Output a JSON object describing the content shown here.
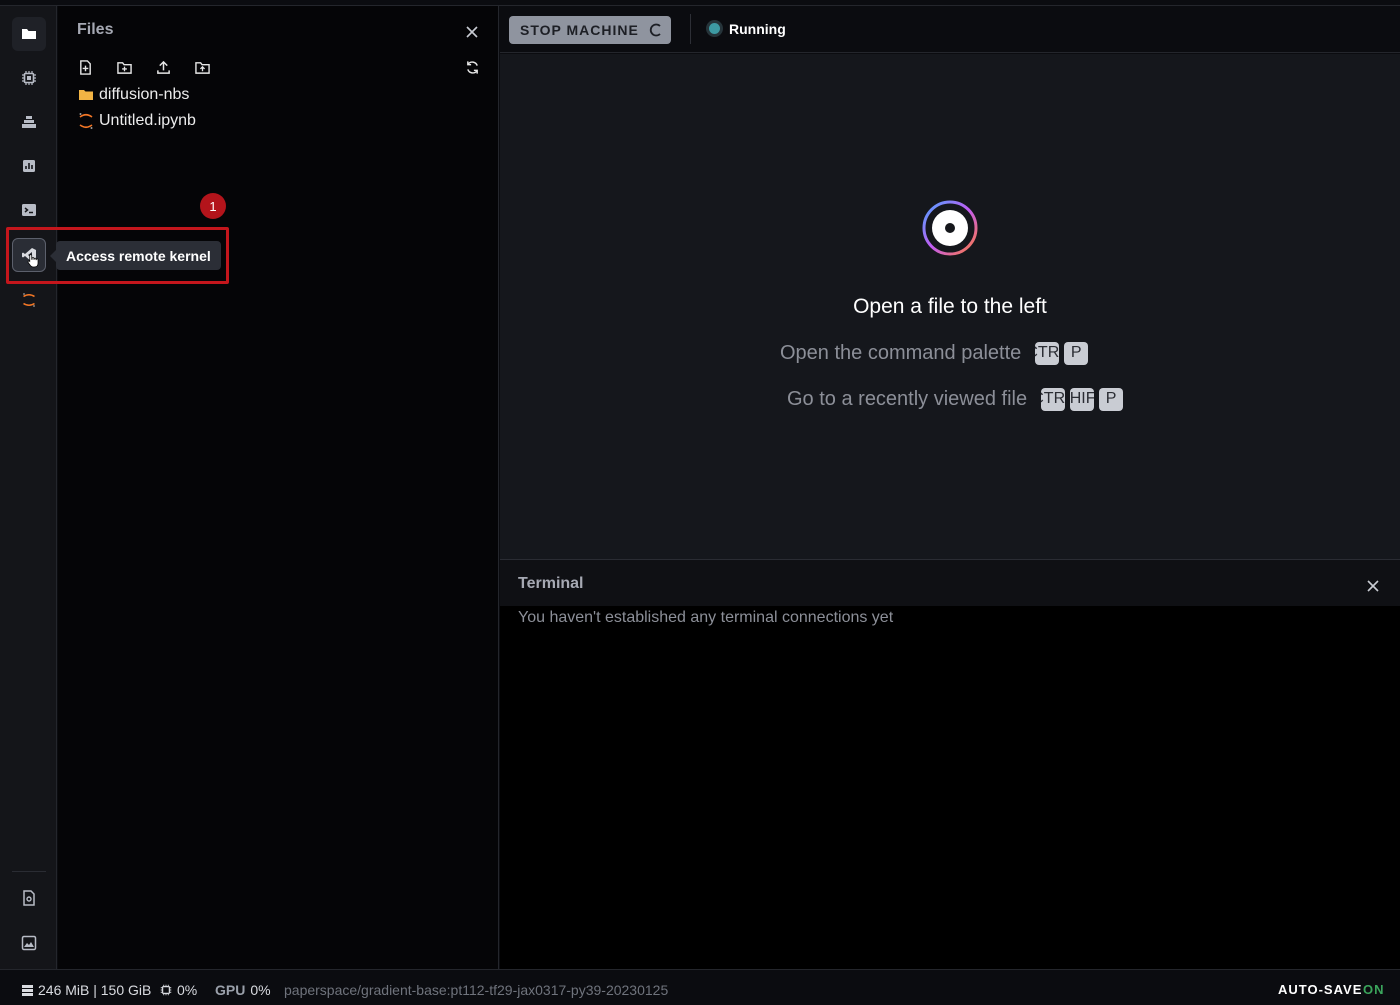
{
  "files_panel": {
    "title": "Files",
    "toolbar_icons": [
      "new-file-icon",
      "new-folder-icon",
      "upload-icon",
      "upload-folder-icon",
      "refresh-icon"
    ],
    "items": [
      {
        "name": "diffusion-nbs",
        "icon": "folder-icon"
      },
      {
        "name": "Untitled.ipynb",
        "icon": "jupyter-icon"
      }
    ]
  },
  "activity_bar": {
    "items": [
      "files-icon",
      "cpu-icon",
      "layers-icon",
      "chart-icon",
      "terminal-icon",
      "vscode-icon",
      "jupyter-icon"
    ],
    "bottom_items": [
      "notebook-icon",
      "image-settings-icon"
    ]
  },
  "annotation": {
    "badge": "1"
  },
  "tooltip": {
    "text": "Access remote kernel"
  },
  "topbar": {
    "stop_button": "STOP MACHINE",
    "status": "Running"
  },
  "editor_empty": {
    "title": "Open a file to the left",
    "shortcuts": [
      {
        "label": "Open the command palette",
        "keys": [
          "CTRL",
          "P"
        ]
      },
      {
        "label": "Go to a recently viewed file",
        "keys": [
          "CTRL",
          "SHIFT",
          "P"
        ]
      }
    ]
  },
  "terminal": {
    "title": "Terminal",
    "message": "You haven't established any terminal connections yet"
  },
  "footer": {
    "memory": "246 MiB | 150 GiB",
    "cpu": "0%",
    "gpu_label": "GPU",
    "gpu": "0%",
    "image": "paperspace/gradient-base:pt112-tf29-jax0317-py39-20230125",
    "autosave_label": "AUTO-SAVE",
    "autosave_state": "ON"
  },
  "colors": {
    "accent_red": "#c4161c",
    "running_dot": "#3d9aa3",
    "autosave_on": "#3ba55c"
  }
}
